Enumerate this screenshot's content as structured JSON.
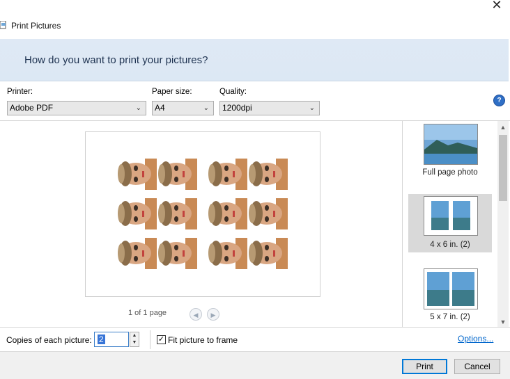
{
  "window": {
    "title": "Print Pictures",
    "close_glyph": "✕"
  },
  "header": {
    "question": "How do you want to print your pictures?"
  },
  "controls": {
    "printer": {
      "label": "Printer:",
      "value": "Adobe PDF"
    },
    "paper_size": {
      "label": "Paper size:",
      "value": "A4"
    },
    "quality": {
      "label": "Quality:",
      "value": "1200dpi"
    }
  },
  "preview": {
    "page_indicator": "1 of 1 page",
    "photos_per_block": 6,
    "blocks": 2
  },
  "layouts": [
    {
      "label": "Full page photo",
      "selected": false
    },
    {
      "label": "4 x 6 in. (2)",
      "selected": true
    },
    {
      "label": "5 x 7 in. (2)",
      "selected": false
    }
  ],
  "bottom": {
    "copies_label": "Copies of each picture:",
    "copies_value": "2",
    "fit_label": "Fit picture to frame",
    "fit_checked": true,
    "options_link": "Options..."
  },
  "buttons": {
    "print": "Print",
    "cancel": "Cancel"
  },
  "colors": {
    "accent": "#0078d7",
    "banner": "#dfe9f5",
    "help": "#2f6fc6"
  }
}
